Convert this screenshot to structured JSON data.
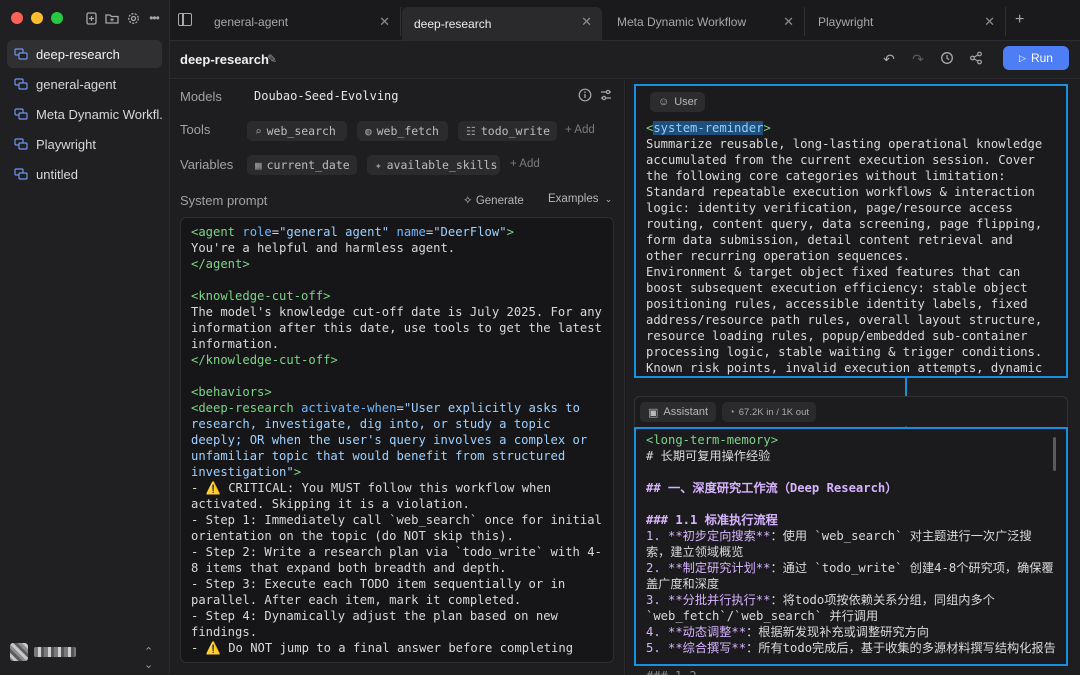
{
  "sidebar": {
    "items": [
      {
        "label": "deep-research",
        "active": true
      },
      {
        "label": "general-agent",
        "active": false
      },
      {
        "label": "Meta Dynamic Workfl...",
        "active": false
      },
      {
        "label": "Playwright",
        "active": false
      },
      {
        "label": "untitled",
        "active": false
      }
    ]
  },
  "tabs": [
    {
      "label": "general-agent"
    },
    {
      "label": "deep-research"
    },
    {
      "label": "Meta Dynamic Workflow"
    },
    {
      "label": "Playwright"
    }
  ],
  "header": {
    "title": "deep-research",
    "run_label": "Run"
  },
  "config": {
    "models_label": "Models",
    "model_name": "Doubao-Seed-Evolving",
    "tools_label": "Tools",
    "tools": [
      "web_search",
      "web_fetch",
      "todo_write"
    ],
    "add_label": "+ Add",
    "variables_label": "Variables",
    "variables": [
      "current_date",
      "available_skills"
    ],
    "system_prompt_label": "System prompt",
    "generate_label": "Generate",
    "examples_label": "Examples"
  },
  "user_message": {
    "role": "User"
  },
  "assistant_message": {
    "role": "Assistant",
    "tokens": "67.2K in / 1K out"
  },
  "colors": {
    "accent": "#4d7ef5",
    "highlight_border": "#1a8fe0"
  }
}
